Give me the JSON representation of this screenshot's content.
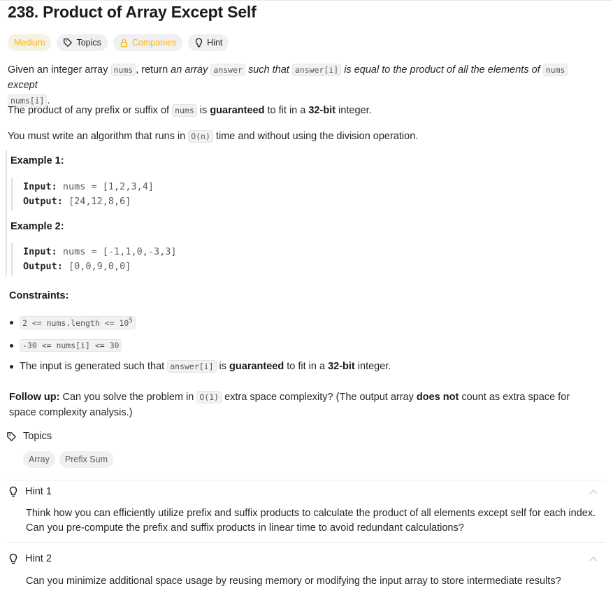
{
  "title": "238. Product of Array Except Self",
  "tags": {
    "difficulty": "Medium",
    "topics": "Topics",
    "companies": "Companies",
    "hint": "Hint"
  },
  "description": {
    "p1": {
      "t1": "Given an integer array ",
      "c1": "nums",
      "t2": ", return ",
      "e1": "an array",
      "t3": " ",
      "c2": "answer",
      "e2": " such that ",
      "c3": "answer[i]",
      "e3": " is equal to the product of all the elements of ",
      "c4": "nums",
      "e4": " except",
      "c5": "nums[i]",
      "t4": "."
    },
    "p2": {
      "t1": "The product of any prefix or suffix of ",
      "c1": "nums",
      "t2": " is ",
      "b1": "guaranteed",
      "t3": " to fit in a ",
      "b2": "32-bit",
      "t4": " integer."
    },
    "p3": {
      "t1": "You must write an algorithm that runs in ",
      "c1": "O(n)",
      "t2": " time and without using the division operation."
    }
  },
  "examples": [
    {
      "heading": "Example 1:",
      "input_label": "Input:",
      "input": " nums = [1,2,3,4]",
      "output_label": "Output:",
      "output": " [24,12,8,6]"
    },
    {
      "heading": "Example 2:",
      "input_label": "Input:",
      "input": " nums = [-1,1,0,-3,3]",
      "output_label": "Output:",
      "output": " [0,0,9,0,0]"
    }
  ],
  "constraints": {
    "heading": "Constraints:",
    "c1": {
      "code": "2 <= nums.length <= 10",
      "sup": "5"
    },
    "c2": {
      "code": "-30 <= nums[i] <= 30"
    },
    "c3": {
      "t1": "The input is generated such that ",
      "code": "answer[i]",
      "t2": " is ",
      "b1": "guaranteed",
      "t3": " to fit in a ",
      "b2": "32-bit",
      "t4": " integer."
    }
  },
  "followup": {
    "label": "Follow up:",
    "t1": " Can you solve the problem in ",
    "code": "O(1)",
    "t2": " extra space complexity? (The output array ",
    "b1": "does not",
    "t3": " count as extra space for space complexity analysis.)"
  },
  "topics_section": {
    "label": "Topics",
    "chips": [
      "Array",
      "Prefix Sum"
    ]
  },
  "hints": [
    {
      "label": "Hint 1",
      "text": "Think how you can efficiently utilize prefix and suffix products to calculate the product of all elements except self for each index. Can you pre-compute the prefix and suffix products in linear time to avoid redundant calculations?"
    },
    {
      "label": "Hint 2",
      "text": "Can you minimize additional space usage by reusing memory or modifying the input array to store intermediate results?"
    }
  ],
  "colors": {
    "accent_medium": "#ffb800",
    "pill_bg": "#f0f0f0"
  },
  "icons": [
    "tag-icon",
    "lock-icon",
    "lightbulb-icon",
    "chevron-up-icon"
  ]
}
